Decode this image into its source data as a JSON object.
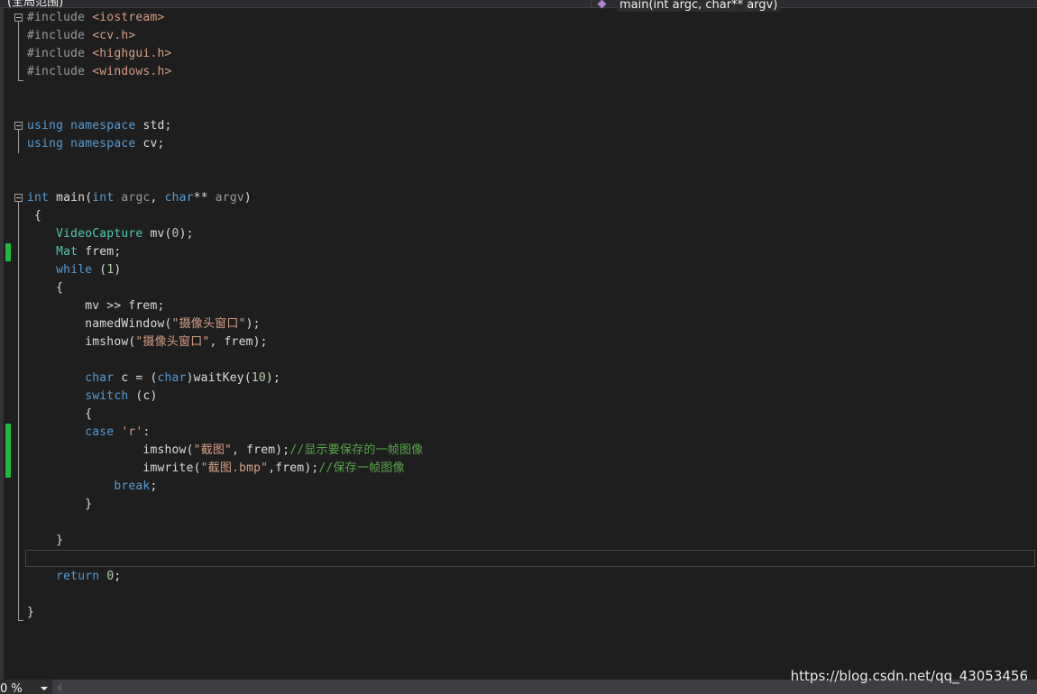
{
  "topbar": {
    "scope": "(全局范围)",
    "function": "main(int argc, char** argv)"
  },
  "code": {
    "lines": [
      [
        [
          "pp",
          "#include "
        ],
        [
          "str",
          "<iostream>"
        ]
      ],
      [
        [
          "pp",
          "#include "
        ],
        [
          "str",
          "<cv.h>"
        ]
      ],
      [
        [
          "pp",
          "#include "
        ],
        [
          "str",
          "<highgui.h>"
        ]
      ],
      [
        [
          "pp",
          "#include "
        ],
        [
          "str",
          "<windows.h>"
        ]
      ],
      [],
      [],
      [
        [
          "kw",
          "using"
        ],
        [
          "pl",
          " "
        ],
        [
          "kw",
          "namespace"
        ],
        [
          "pl",
          " std;"
        ]
      ],
      [
        [
          "kw",
          "using"
        ],
        [
          "pl",
          " "
        ],
        [
          "kw",
          "namespace"
        ],
        [
          "pl",
          " cv;"
        ]
      ],
      [],
      [],
      [
        [
          "kw",
          "int"
        ],
        [
          "pl",
          " main("
        ],
        [
          "kw",
          "int"
        ],
        [
          "prm",
          " argc"
        ],
        [
          "pl",
          ", "
        ],
        [
          "kw",
          "char"
        ],
        [
          "pl",
          "** "
        ],
        [
          "prm",
          "argv"
        ],
        [
          "pl",
          ")"
        ]
      ],
      [
        [
          "pl",
          " {"
        ]
      ],
      [
        [
          "pl",
          "    "
        ],
        [
          "ty",
          "VideoCapture"
        ],
        [
          "pl",
          " mv("
        ],
        [
          "num",
          "0"
        ],
        [
          "pl",
          ");"
        ]
      ],
      [
        [
          "pl",
          "    "
        ],
        [
          "ty",
          "Mat"
        ],
        [
          "pl",
          " frem;"
        ]
      ],
      [
        [
          "pl",
          "    "
        ],
        [
          "kw",
          "while"
        ],
        [
          "pl",
          " ("
        ],
        [
          "num",
          "1"
        ],
        [
          "pl",
          ")"
        ]
      ],
      [
        [
          "pl",
          "    {"
        ]
      ],
      [
        [
          "pl",
          "        mv >> frem;"
        ]
      ],
      [
        [
          "pl",
          "        namedWindow("
        ],
        [
          "str",
          "\"摄像头窗口\""
        ],
        [
          "pl",
          ");"
        ]
      ],
      [
        [
          "pl",
          "        imshow("
        ],
        [
          "str",
          "\"摄像头窗口\""
        ],
        [
          "pl",
          ", frem);"
        ]
      ],
      [],
      [
        [
          "pl",
          "        "
        ],
        [
          "kw",
          "char"
        ],
        [
          "pl",
          " c = ("
        ],
        [
          "kw",
          "char"
        ],
        [
          "pl",
          ")waitKey("
        ],
        [
          "num",
          "10"
        ],
        [
          "pl",
          ");"
        ]
      ],
      [
        [
          "pl",
          "        "
        ],
        [
          "kw",
          "switch"
        ],
        [
          "pl",
          " (c)"
        ]
      ],
      [
        [
          "pl",
          "        {"
        ]
      ],
      [
        [
          "pl",
          "        "
        ],
        [
          "kw",
          "case"
        ],
        [
          "pl",
          " "
        ],
        [
          "str",
          "'r'"
        ],
        [
          "pl",
          ":"
        ]
      ],
      [
        [
          "pl",
          "                imshow("
        ],
        [
          "str",
          "\"截图\""
        ],
        [
          "pl",
          ", frem);"
        ],
        [
          "cm",
          "//显示要保存的一帧图像"
        ]
      ],
      [
        [
          "pl",
          "                imwrite("
        ],
        [
          "str",
          "\"截图.bmp\""
        ],
        [
          "pl",
          ",frem);"
        ],
        [
          "cm",
          "//保存一帧图像"
        ]
      ],
      [
        [
          "pl",
          "            "
        ],
        [
          "kw",
          "break"
        ],
        [
          "pl",
          ";"
        ]
      ],
      [
        [
          "pl",
          "        }"
        ]
      ],
      [],
      [
        [
          "pl",
          "    }"
        ]
      ],
      [],
      [
        [
          "pl",
          "    "
        ],
        [
          "kw",
          "return"
        ],
        [
          "pl",
          " "
        ],
        [
          "num",
          "0"
        ],
        [
          "pl",
          ";"
        ]
      ],
      [],
      [
        [
          "pl",
          "}"
        ]
      ]
    ]
  },
  "statusbar": {
    "zoom": "0 %"
  },
  "watermark": "https://blog.csdn.net/qq_43053456"
}
